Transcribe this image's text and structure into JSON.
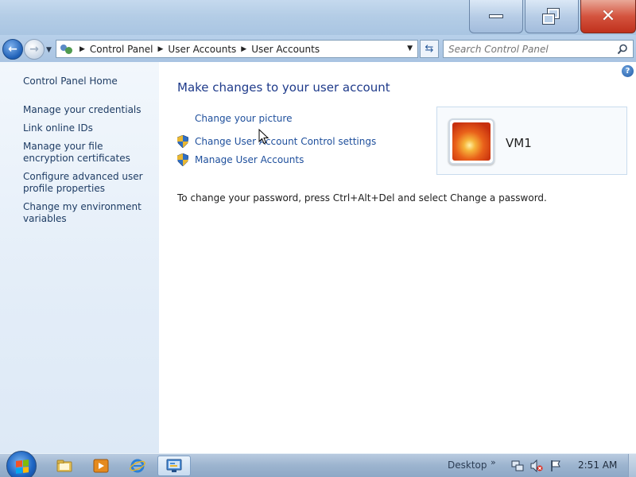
{
  "window": {
    "buttons": {
      "minimize": "minimize",
      "maximize": "restore",
      "close": "close"
    }
  },
  "navbar": {
    "breadcrumb": [
      "Control Panel",
      "User Accounts",
      "User Accounts"
    ],
    "search_placeholder": "Search Control Panel"
  },
  "sidebar": {
    "items": [
      {
        "label": "Control Panel Home"
      },
      {
        "label": "Manage your credentials"
      },
      {
        "label": "Link online IDs"
      },
      {
        "label": "Manage your file encryption certificates"
      },
      {
        "label": "Configure advanced user profile properties"
      },
      {
        "label": "Change my environment variables"
      }
    ]
  },
  "main": {
    "heading": "Make changes to your user account",
    "links": [
      {
        "label": "Change your picture",
        "icon": "none"
      },
      {
        "label": "Change User Account Control settings",
        "icon": "shield-icon"
      },
      {
        "label": "Manage User Accounts",
        "icon": "shield-icon"
      }
    ],
    "password_info": "To change your password, press Ctrl+Alt+Del and select Change a password.",
    "user": {
      "name": "VM1",
      "picture": "flower-picture"
    }
  },
  "taskbar": {
    "pinned": [
      "explorer-icon",
      "media-player-icon",
      "internet-explorer-icon",
      "control-panel-icon"
    ],
    "desktop_label": "Desktop",
    "clock": "2:51 AM"
  },
  "colors": {
    "link": "#1e4f9c",
    "heading": "#1e3a8a",
    "close_button": "#c7341f"
  }
}
